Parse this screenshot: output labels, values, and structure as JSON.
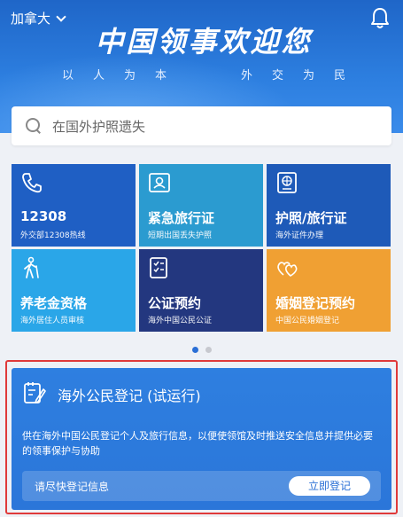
{
  "header": {
    "region": "加拿大",
    "title": "中国领事欢迎您",
    "subtitle_left": [
      "以",
      "人",
      "为",
      "本"
    ],
    "subtitle_right": [
      "外",
      "交",
      "为",
      "民"
    ]
  },
  "search": {
    "placeholder": "在国外护照遗失"
  },
  "tiles": [
    {
      "title": "12308",
      "sub": "外交部12308热线",
      "icon": "phone-icon"
    },
    {
      "title": "紧急旅行证",
      "sub": "短期出国丢失护照",
      "icon": "id-card-icon"
    },
    {
      "title": "护照/旅行证",
      "sub": "海外证件办理",
      "icon": "passport-icon"
    },
    {
      "title": "养老金资格",
      "sub": "海外居住人员审核",
      "icon": "elderly-icon"
    },
    {
      "title": "公证预约",
      "sub": "海外中国公民公证",
      "icon": "notary-icon"
    },
    {
      "title": "婚姻登记预约",
      "sub": "中国公民婚姻登记",
      "icon": "hearts-icon"
    }
  ],
  "pager": {
    "count": 2,
    "active": 1
  },
  "registration": {
    "title": "海外公民登记 (试运行)",
    "description": "供在海外中国公民登记个人及旅行信息，以便使领馆及时推送安全信息并提供必要的领事保护与协助",
    "hint": "请尽快登记信息",
    "button": "立即登记"
  },
  "colors": {
    "hero": "#2d7fe0",
    "highlight_border": "#e03a3a",
    "accent": "#2a6fd6"
  }
}
